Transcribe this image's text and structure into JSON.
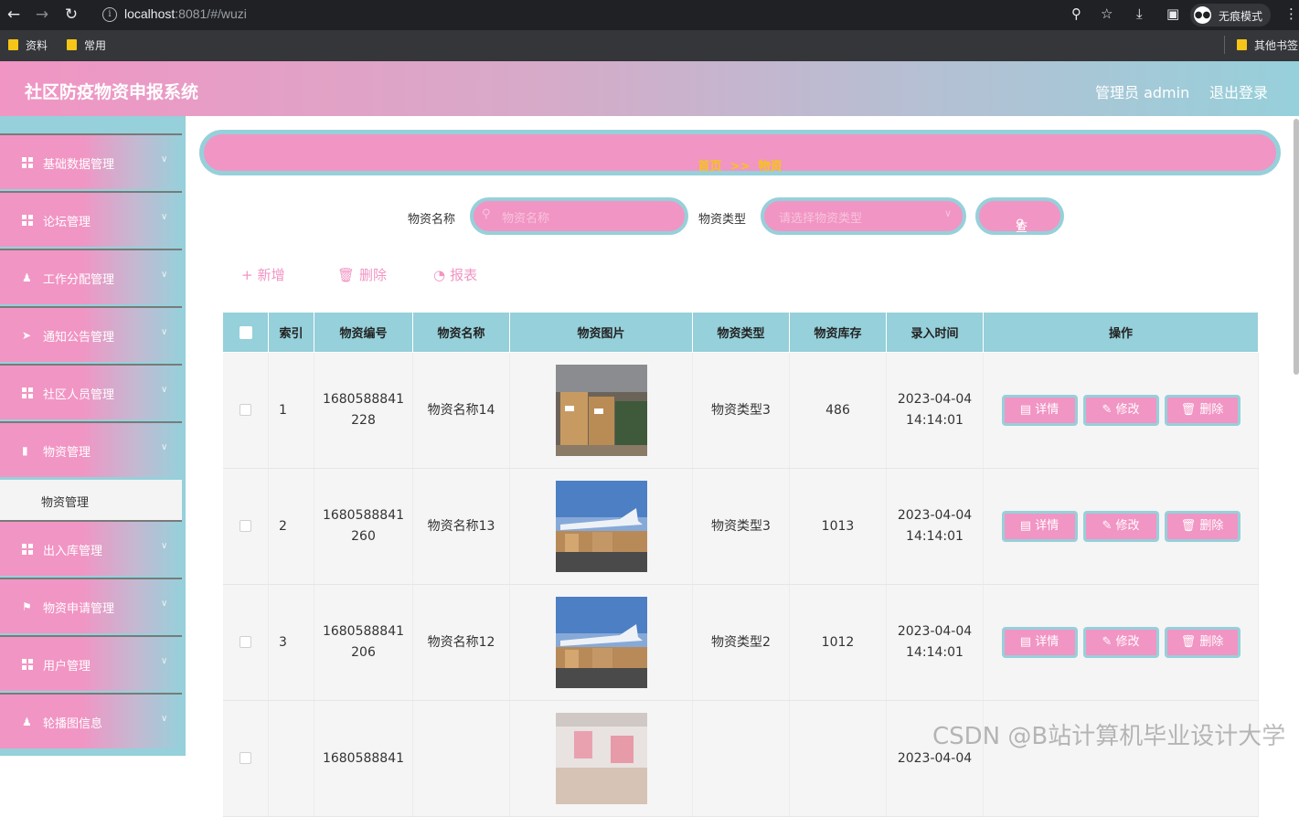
{
  "browser": {
    "url_host": "localhost",
    "url_rest": ":8081/#/wuzi",
    "incognito_label": "无痕模式",
    "bookmarks": [
      "资料",
      "常用"
    ],
    "other_bookmarks": "其他书签"
  },
  "header": {
    "title": "社区防疫物资申报系统",
    "admin": "管理员 admin",
    "logout": "退出登录"
  },
  "sidebar": {
    "items": [
      {
        "label": "基础数据管理",
        "icon": "grid-icon"
      },
      {
        "label": "论坛管理",
        "icon": "grid-icon"
      },
      {
        "label": "工作分配管理",
        "icon": "user-icon"
      },
      {
        "label": "通知公告管理",
        "icon": "send-icon"
      },
      {
        "label": "社区人员管理",
        "icon": "grid-icon"
      },
      {
        "label": "物资管理",
        "icon": "bar-chart-icon"
      },
      {
        "label": "出入库管理",
        "icon": "grid-icon"
      },
      {
        "label": "物资申请管理",
        "icon": "flag-icon"
      },
      {
        "label": "用户管理",
        "icon": "grid-icon"
      },
      {
        "label": "轮播图信息",
        "icon": "user-icon"
      }
    ],
    "active_sub": "物资管理"
  },
  "breadcrumb": {
    "home": "首页",
    "sep": ">>",
    "current": "物资"
  },
  "search": {
    "name_label": "物资名称",
    "name_placeholder": "物资名称",
    "type_label": "物资类型",
    "type_placeholder": "请选择物资类型",
    "query_label": "查询"
  },
  "actions": {
    "add": "新增",
    "delete": "删除",
    "report": "报表"
  },
  "table": {
    "headers": [
      "索引",
      "物资编号",
      "物资名称",
      "物资图片",
      "物资类型",
      "物资库存",
      "录入时间",
      "操作"
    ],
    "rows": [
      {
        "index": "1",
        "code_a": "1680588841",
        "code_b": "228",
        "name": "物资名称14",
        "type": "物资类型3",
        "stock": "486",
        "date": "2023-04-04",
        "time": "14:14:01",
        "image": "boxes"
      },
      {
        "index": "2",
        "code_a": "1680588841",
        "code_b": "260",
        "name": "物资名称13",
        "type": "物资类型3",
        "stock": "1013",
        "date": "2023-04-04",
        "time": "14:14:01",
        "image": "plane"
      },
      {
        "index": "3",
        "code_a": "1680588841",
        "code_b": "206",
        "name": "物资名称12",
        "type": "物资类型2",
        "stock": "1012",
        "date": "2023-04-04",
        "time": "14:14:01",
        "image": "plane"
      },
      {
        "index": "",
        "code_a": "1680588841",
        "code_b": "",
        "name": "",
        "type": "",
        "stock": "",
        "date": "2023-04-04",
        "time": "",
        "image": "warehouse"
      }
    ],
    "ops": {
      "detail": "详情",
      "edit": "修改",
      "delete": "删除"
    }
  },
  "watermark": "CSDN @B站计算机毕业设计大学",
  "colors": {
    "pink": "#f195c4",
    "teal": "#96d0da",
    "yellow": "#f5c518"
  }
}
